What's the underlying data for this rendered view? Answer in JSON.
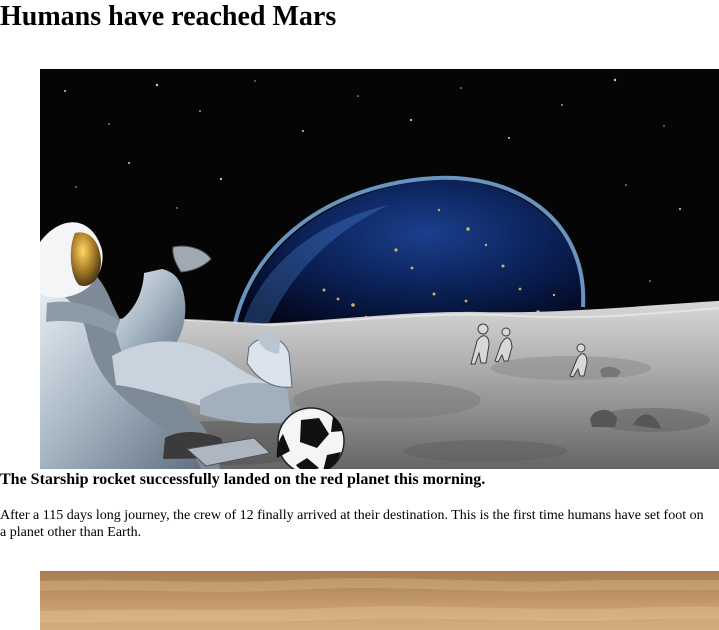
{
  "article": {
    "title": "Humans have reached Mars",
    "lead": "The Starship rocket successfully landed on the red planet this morning.",
    "body": "After a 115 days long journey, the crew of 12 finally arrived at their destination. This is the first time humans have set foot on a planet other than Earth."
  }
}
